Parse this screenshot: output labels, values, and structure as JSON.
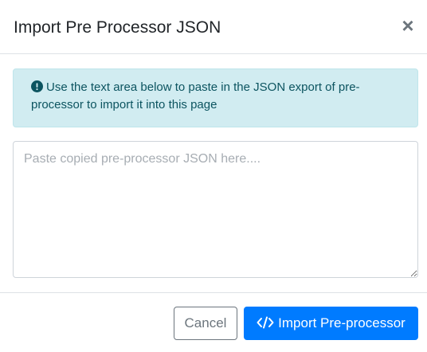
{
  "header": {
    "title": "Import Pre Processor JSON",
    "close_glyph": "×"
  },
  "alert": {
    "icon": "exclamation-circle-icon",
    "message": "Use the text area below to paste in the JSON export of pre-processor to import it into this page"
  },
  "json_input": {
    "value": "",
    "placeholder": "Paste copied pre-processor JSON here...."
  },
  "footer": {
    "cancel_label": "Cancel",
    "import_label": "Import Pre-processor",
    "import_icon": "code-icon"
  },
  "colors": {
    "alert_background": "#d1ecf1",
    "alert_text": "#0c5460",
    "primary": "#007bff",
    "secondary": "#6c757d"
  }
}
